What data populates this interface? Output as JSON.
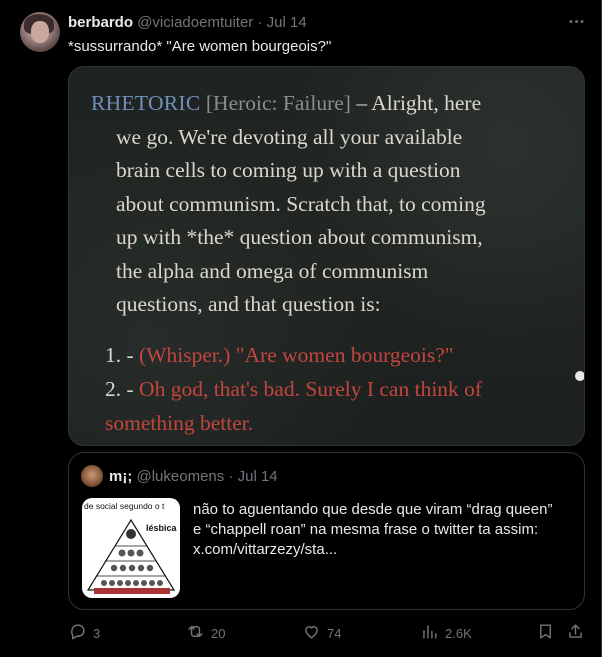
{
  "tweet": {
    "display_name": "berbardo",
    "handle": "@viciadoemtuiter",
    "separator": "·",
    "date": "Jul 14",
    "text": "*sussurrando* \"Are women bourgeois?\""
  },
  "game_dialog": {
    "speaker": "RHETORIC",
    "check": "[Heroic: Failure]",
    "dash": "–",
    "lines": [
      "Alright, here",
      "we go. We're devoting all your available",
      "brain cells to coming up with a question",
      "about communism. Scratch that, to coming",
      "up with *the* question about communism,",
      "the alpha and omega of communism",
      "questions, and that question is:"
    ],
    "options": [
      {
        "number": "1. -",
        "lines": [
          "(Whisper.) \"Are women bourgeois?\""
        ]
      },
      {
        "number": "2. -",
        "lines": [
          "Oh god, that's bad. Surely I can think of",
          "something better."
        ]
      }
    ],
    "colors": {
      "speaker": "#6f8fba",
      "option_text": "#c4453d",
      "body": "#ddd7cb"
    }
  },
  "quoted": {
    "display_name": "m¡;",
    "handle": "@lukeomens",
    "separator": "·",
    "date": "Jul 14",
    "thumb_caption": "de social segundo o t",
    "thumb_label": "lésbica",
    "text_lines": [
      "não to aguentando que desde que viram “drag queen”",
      "e “chappell roan” na mesma frase o twitter ta assim:",
      "x.com/vittarzezy/sta..."
    ]
  },
  "actions": {
    "replies": "3",
    "reposts": "20",
    "likes": "74",
    "views": "2.6K"
  },
  "icons": [
    "more-icon",
    "reply-icon",
    "repost-icon",
    "like-icon",
    "views-icon",
    "bookmark-icon",
    "share-icon"
  ]
}
